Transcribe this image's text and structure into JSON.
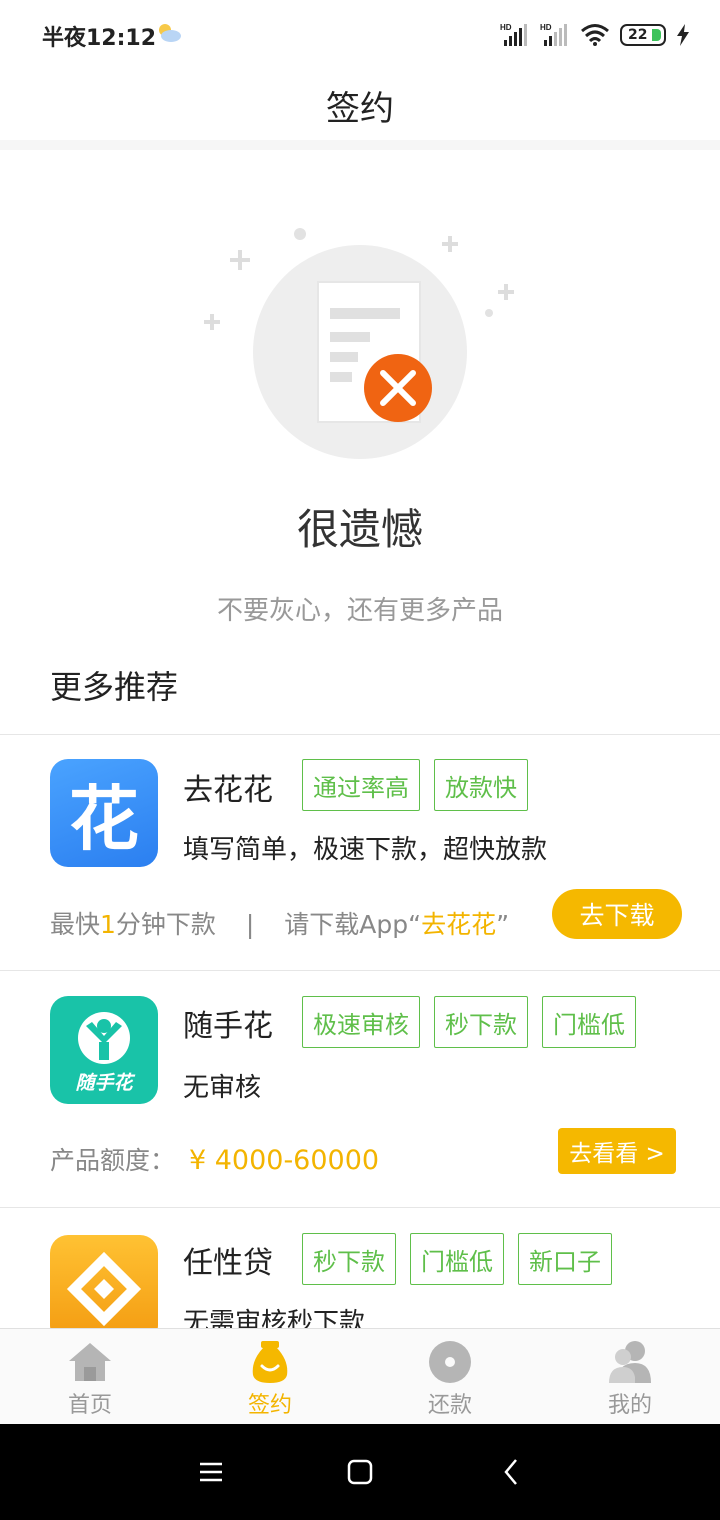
{
  "status_bar": {
    "time": "半夜12:12",
    "battery": "22"
  },
  "header": {
    "title": "签约"
  },
  "empty_state": {
    "title": "很遗憾",
    "subtitle": "不要灰心，还有更多产品"
  },
  "recommend": {
    "title": "更多推荐",
    "products": [
      {
        "name": "去花花",
        "icon_text": "花",
        "tags": [
          "通过率高",
          "放款快"
        ],
        "desc": "填写简单，极速下款，超快放款",
        "foot_prefix": "最快",
        "foot_num": "1",
        "foot_mid": "分钟下款",
        "foot_sep": "|",
        "foot_download": "请下载App“",
        "foot_app": "去花花",
        "foot_close": "”",
        "button": "去下载"
      },
      {
        "name": "随手花",
        "icon_text": "随手花",
        "tags": [
          "极速审核",
          "秒下款",
          "门槛低"
        ],
        "desc": "无审核",
        "amount_label": "产品额度：",
        "amount_value": "¥ 4000-60000",
        "button": "去看看 >"
      },
      {
        "name": "任性贷",
        "tags": [
          "秒下款",
          "门槛低",
          "新口子"
        ],
        "desc": "无需审核秒下款"
      }
    ]
  },
  "bottom_nav": {
    "items": [
      {
        "label": "首页",
        "icon": "home-icon",
        "active": false
      },
      {
        "label": "签约",
        "icon": "moneybag-icon",
        "active": true
      },
      {
        "label": "还款",
        "icon": "disc-icon",
        "active": false
      },
      {
        "label": "我的",
        "icon": "user-icon",
        "active": false
      }
    ]
  },
  "colors": {
    "accent": "#f5b800",
    "tag_green": "#5fbf4a",
    "error_orange": "#f06412"
  }
}
